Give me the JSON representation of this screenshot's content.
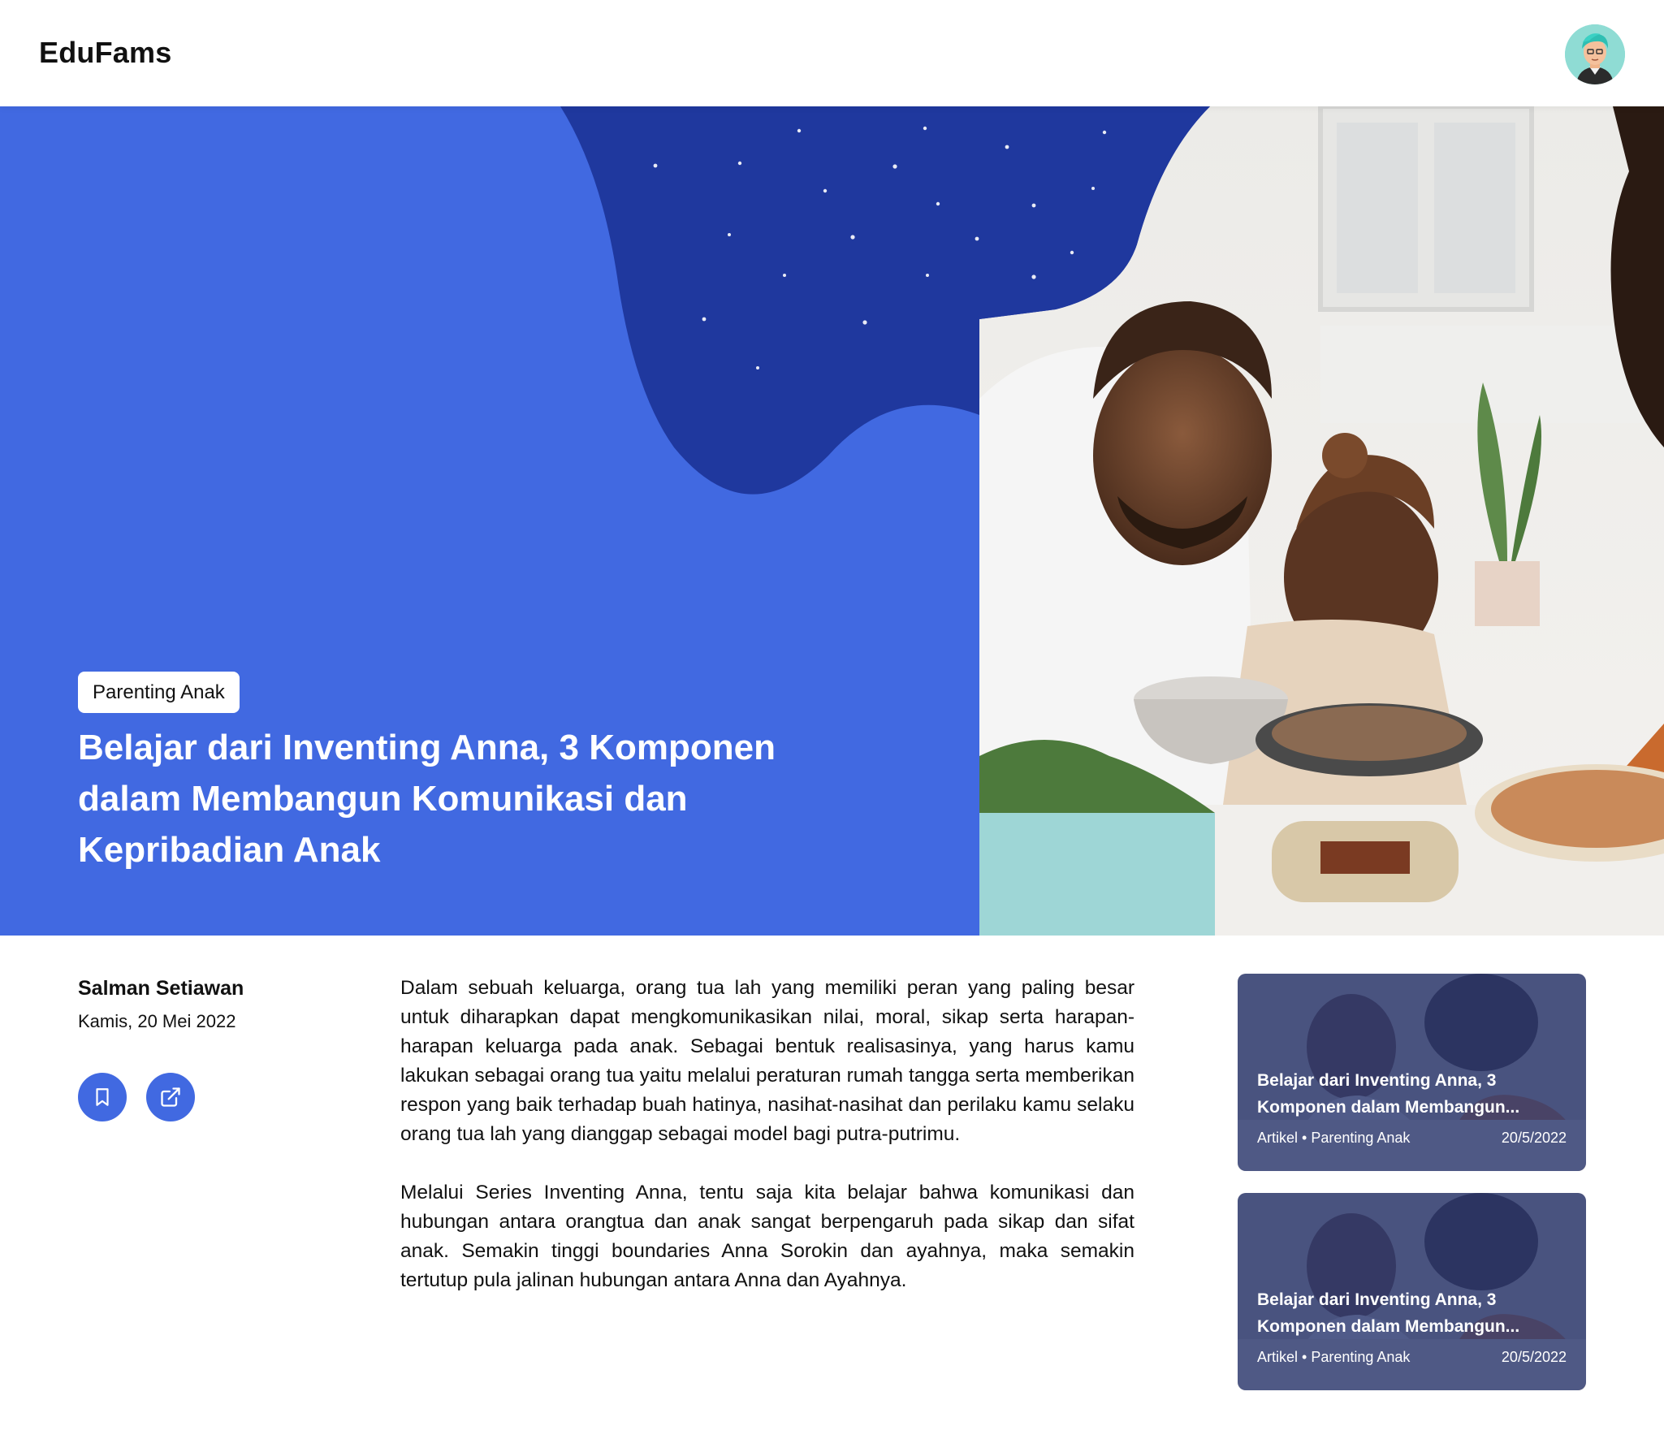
{
  "header": {
    "brand": "EduFams",
    "avatar_icon": "user-avatar-icon"
  },
  "hero": {
    "category": "Parenting Anak",
    "title": "Belajar dari Inventing Anna, 3 Komponen dalam Membangun Komunikasi dan Kepribadian Anak",
    "accent_color": "#4169e1",
    "blob_color": "#1f389e"
  },
  "author": {
    "name": "Salman Setiawan",
    "date": "Kamis, 20 Mei 2022",
    "bookmark_icon": "bookmark-icon",
    "share_icon": "share-icon"
  },
  "article": {
    "paragraphs": [
      "Dalam sebuah keluarga, orang tua lah yang memiliki peran yang paling besar untuk diharapkan dapat mengkomunikasikan nilai, moral, sikap serta harapan-harapan keluarga pada anak. Sebagai bentuk realisasinya, yang harus kamu lakukan sebagai orang tua yaitu melalui peraturan rumah tangga serta memberikan respon yang baik terhadap buah hatinya, nasihat-nasihat dan perilaku kamu selaku orang tua lah yang dianggap sebagai model bagi putra-putrimu.",
      "Melalui Series Inventing Anna, tentu saja kita belajar bahwa komunikasi dan hubungan antara orangtua dan anak sangat berpengaruh pada sikap dan sifat anak. Semakin tinggi boundaries Anna Sorokin dan ayahnya, maka semakin tertutup pula jalinan hubungan antara Anna dan Ayahnya."
    ]
  },
  "related": [
    {
      "title": "Belajar dari Inventing Anna, 3 Komponen dalam Membangun...",
      "meta": "Artikel • Parenting Anak",
      "date": "20/5/2022"
    },
    {
      "title": "Belajar dari Inventing Anna, 3 Komponen dalam Membangun...",
      "meta": "Artikel • Parenting Anak",
      "date": "20/5/2022"
    }
  ]
}
